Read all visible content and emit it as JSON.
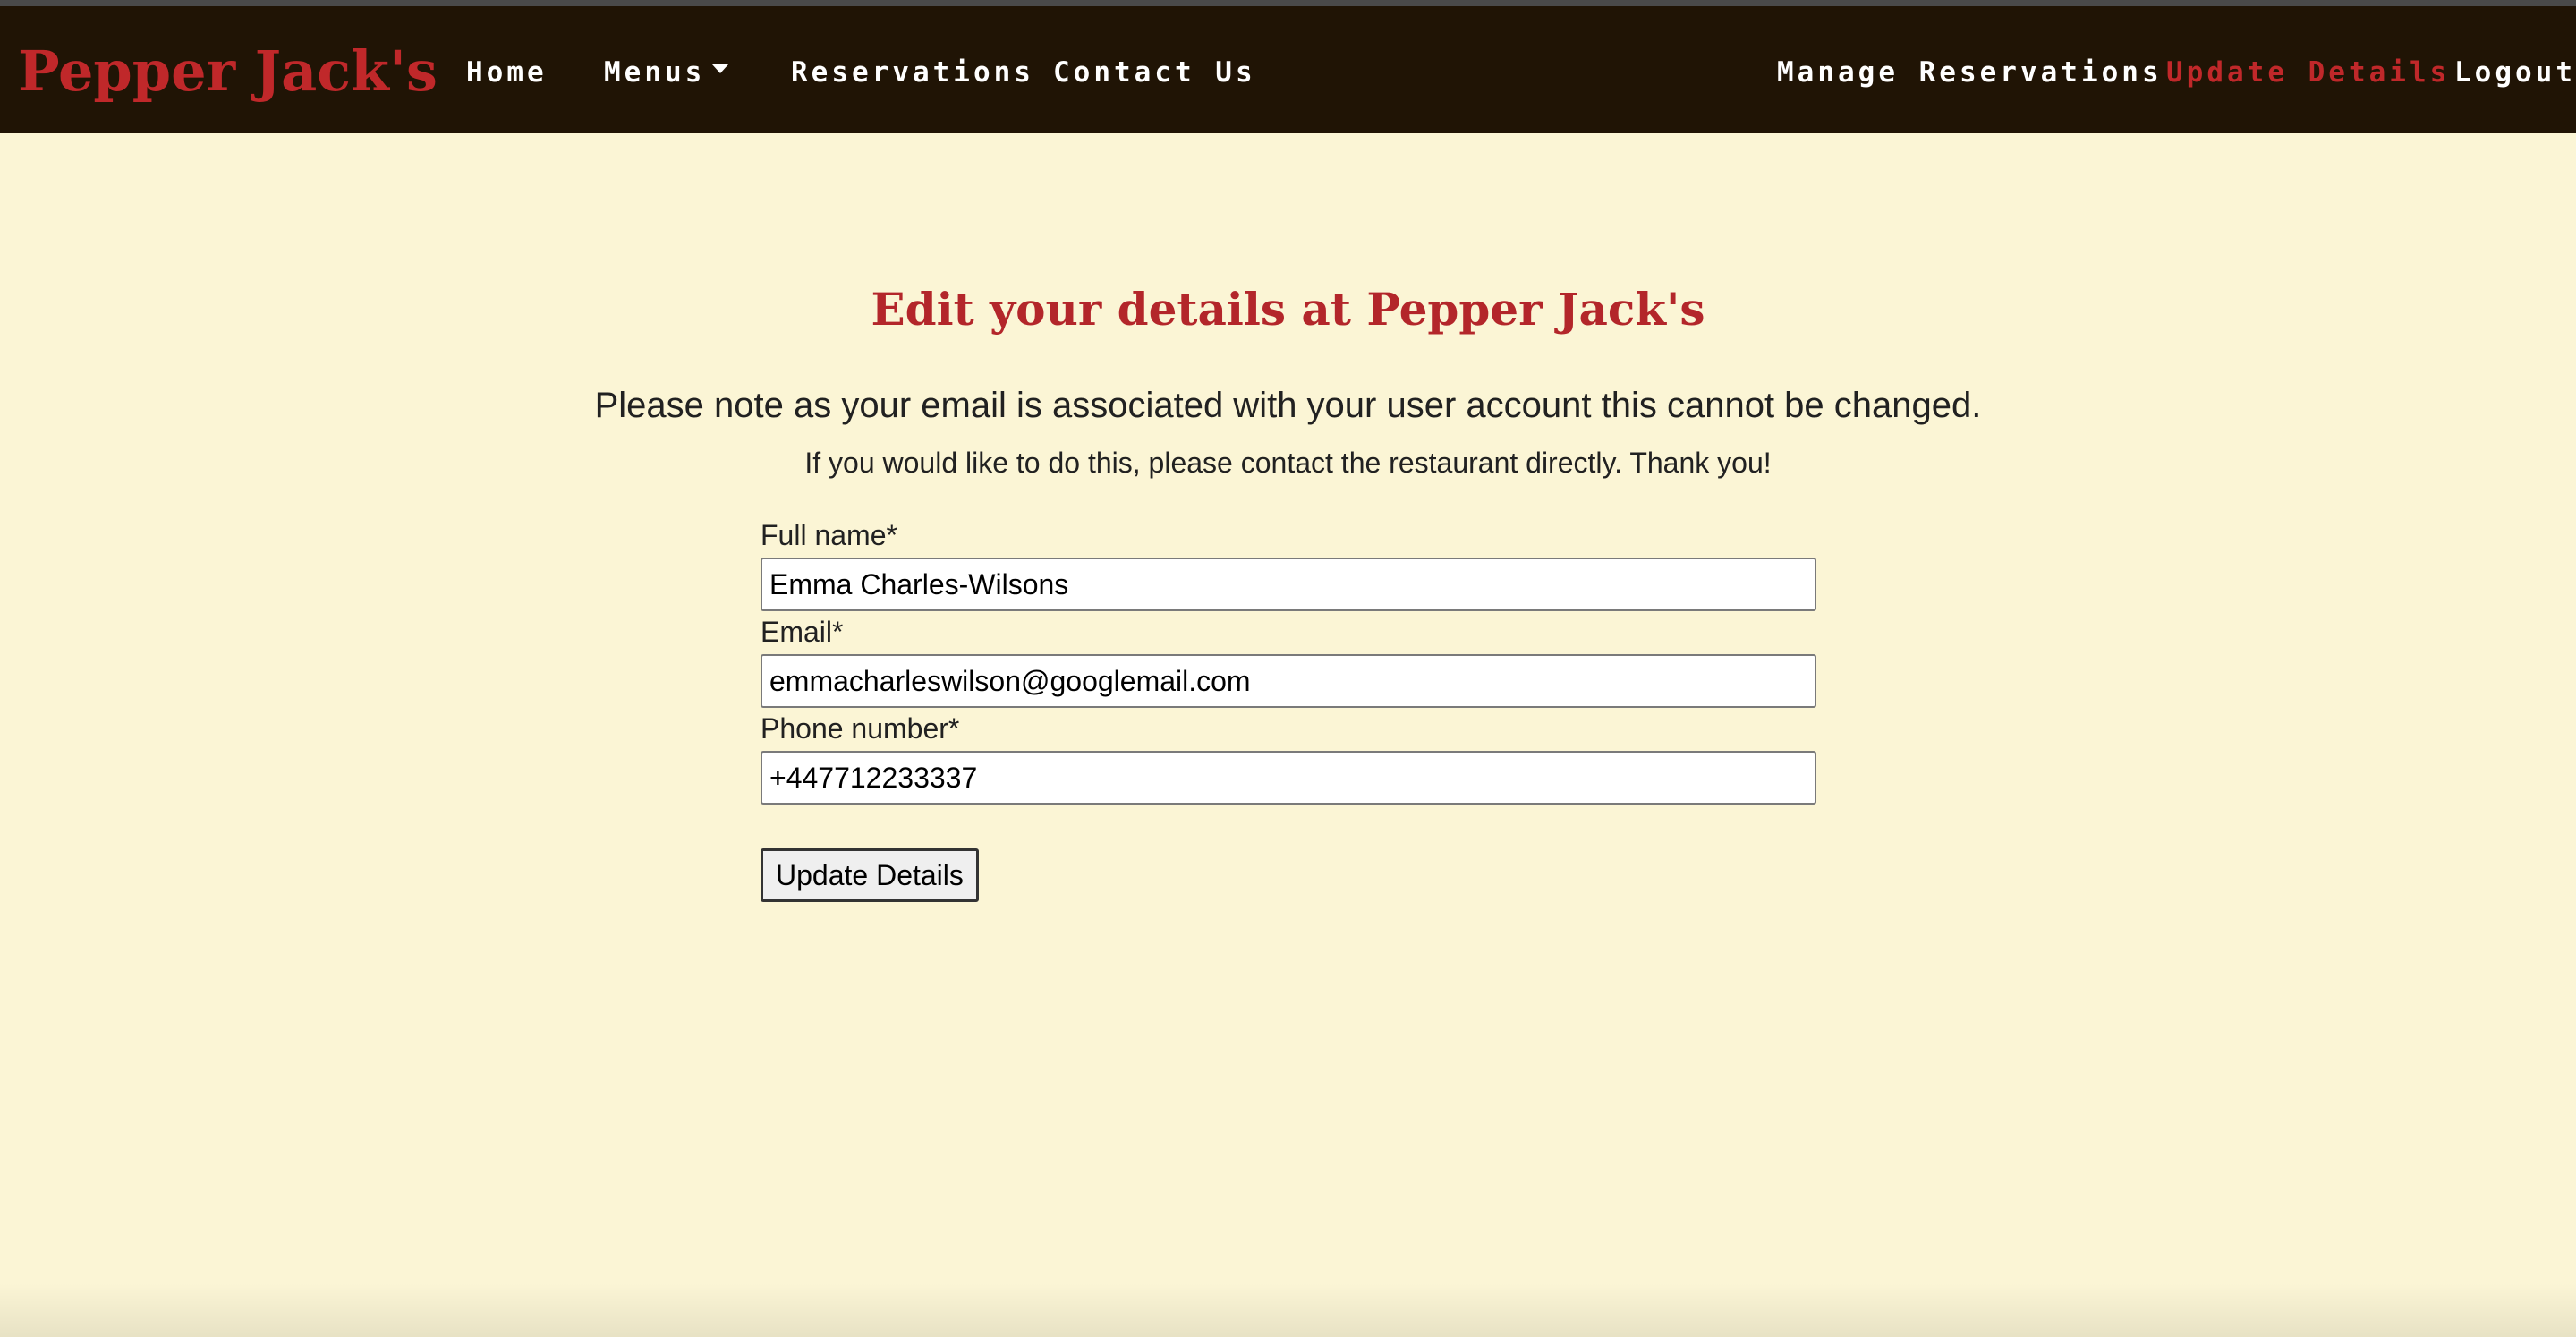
{
  "nav": {
    "brand": "Pepper Jack's",
    "items": [
      {
        "label": "Home"
      },
      {
        "label": "Menus"
      },
      {
        "label": "Reservations"
      },
      {
        "label": "Contact Us"
      }
    ],
    "right_items": [
      {
        "label": "Manage Reservations"
      },
      {
        "label": "Update Details",
        "active": true
      },
      {
        "label": "Logout"
      }
    ]
  },
  "page": {
    "title": "Edit your details at Pepper Jack's",
    "note": "Please note as your email is associated with your user account this cannot be changed.",
    "subnote": "If you would like to do this, please contact the restaurant directly. Thank you!"
  },
  "form": {
    "full_name_label": "Full name*",
    "full_name_value": "Emma Charles-Wilsons",
    "email_label": "Email*",
    "email_value": "emmacharleswilson@googlemail.com",
    "phone_label": "Phone number*",
    "phone_value": "+447712233337",
    "submit_label": "Update Details"
  },
  "colors": {
    "navbar_bg": "#201405",
    "page_bg": "#fbf5d5",
    "accent_red": "#c0282a"
  },
  "icons": {
    "menus_dropdown": "caret-down-icon"
  }
}
